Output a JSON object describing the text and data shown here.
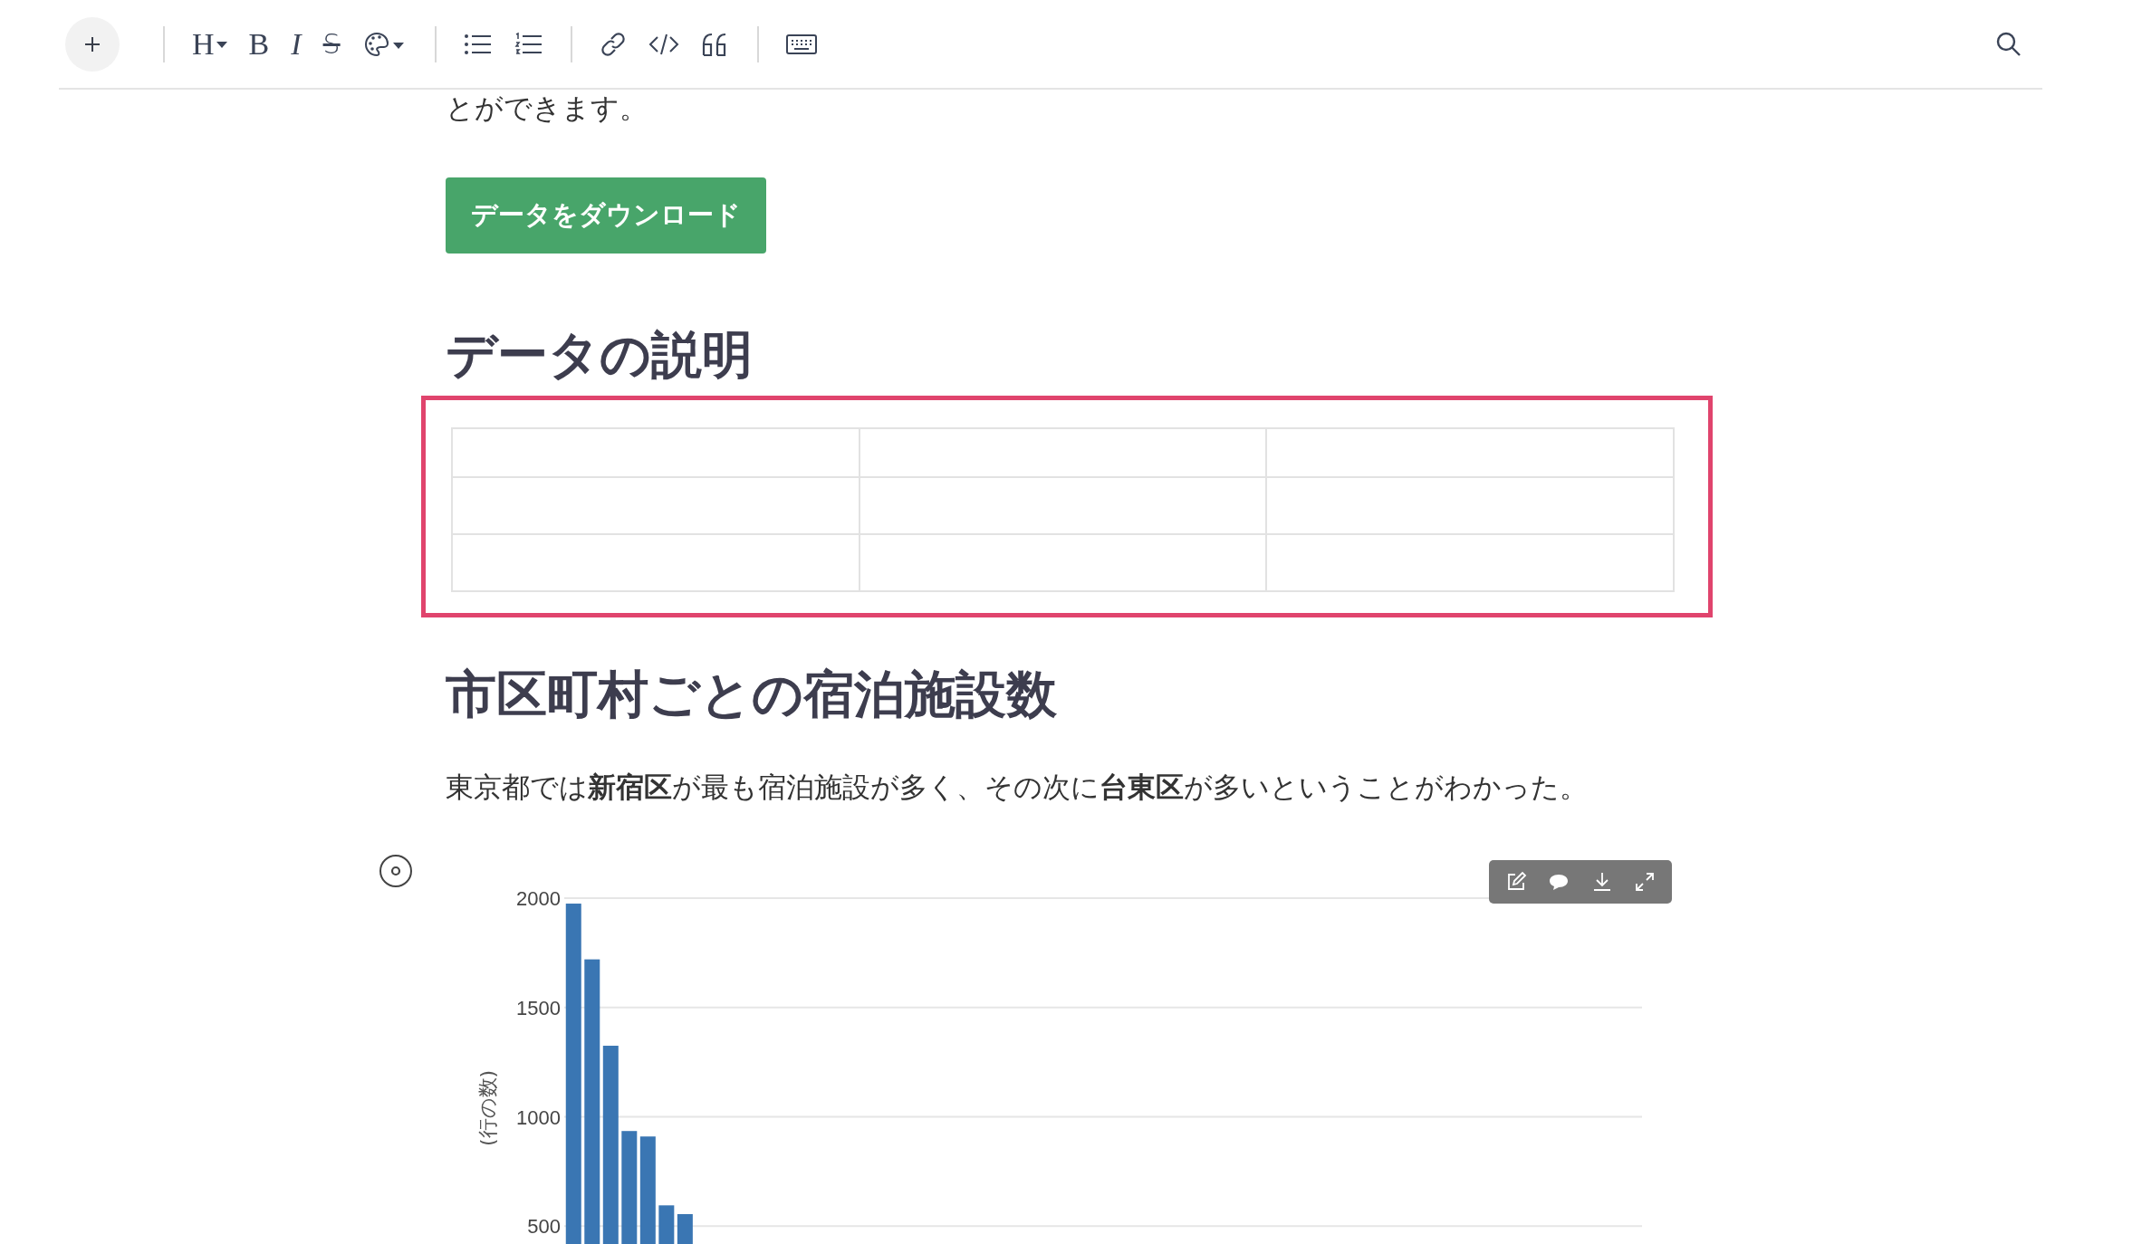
{
  "toolbar": {
    "groups": [
      [
        {
          "kind": "add"
        }
      ],
      [
        {
          "kind": "heading",
          "label": "H"
        },
        {
          "kind": "bold",
          "label": "B"
        },
        {
          "kind": "italic",
          "label": "I"
        },
        {
          "kind": "strike",
          "label": "S"
        },
        {
          "kind": "color"
        }
      ],
      [
        {
          "kind": "bullets"
        },
        {
          "kind": "numbers"
        }
      ],
      [
        {
          "kind": "link"
        },
        {
          "kind": "code"
        },
        {
          "kind": "quote"
        }
      ],
      [
        {
          "kind": "keyboard"
        }
      ]
    ]
  },
  "intro_tail": "とができます。",
  "download_button": "データをダウンロード",
  "section_1": {
    "heading": "データの説明",
    "table": {
      "selected": true,
      "rows": [
        {
          "kind": "header",
          "cells": [
            {
              "kind": "empty"
            },
            {
              "kind": "empty"
            },
            {
              "kind": "empty"
            }
          ]
        },
        {
          "kind": "body",
          "cells": [
            {
              "kind": "empty"
            },
            {
              "kind": "empty"
            },
            {
              "kind": "empty"
            }
          ]
        },
        {
          "kind": "body",
          "cells": [
            {
              "kind": "empty"
            },
            {
              "kind": "empty"
            },
            {
              "kind": "empty"
            }
          ]
        }
      ]
    }
  },
  "section_2": {
    "heading": "市区町村ごとの宿泊施設数",
    "text": "東京都では**新宿区**が最も宿泊施設が多く、その次に**台東区**が多いということがわかった。",
    "chart_tools": [
      {
        "kind": "edit"
      },
      {
        "kind": "comment"
      },
      {
        "kind": "download"
      },
      {
        "kind": "expand"
      }
    ],
    "chart_data": {
      "type": "bar",
      "ylabel": "(行の数)",
      "orientation": "vertical",
      "categories": [
        null,
        null,
        null,
        null,
        null,
        null,
        null,
        null,
        null,
        null,
        null,
        null,
        null,
        null,
        null,
        null,
        null,
        null,
        null,
        null,
        null,
        null,
        null,
        null,
        null,
        null,
        null,
        null,
        null,
        null,
        null,
        null,
        null,
        null,
        null,
        null,
        null,
        null,
        null,
        null,
        null,
        null,
        null,
        null,
        null,
        null,
        null,
        null,
        null,
        null,
        null,
        null,
        null,
        null,
        null,
        null,
        null,
        null
      ],
      "grid": true,
      "values": [
        1975,
        1720,
        1325,
        935,
        910,
        595,
        555,
        null,
        null,
        null,
        null,
        null,
        null,
        null,
        null,
        null,
        null,
        null,
        null,
        null,
        null,
        null,
        null,
        null,
        null,
        null,
        null,
        null,
        null,
        null,
        null,
        null,
        null,
        null,
        null,
        null,
        null,
        null,
        null,
        null,
        null,
        null,
        null,
        null,
        null,
        null,
        null,
        null,
        null,
        null,
        null,
        null,
        null,
        null,
        null,
        null,
        null,
        null
      ],
      "ylim": [
        410,
        2000
      ],
      "yticks": [
        500,
        1000,
        1500,
        2000
      ]
    }
  }
}
